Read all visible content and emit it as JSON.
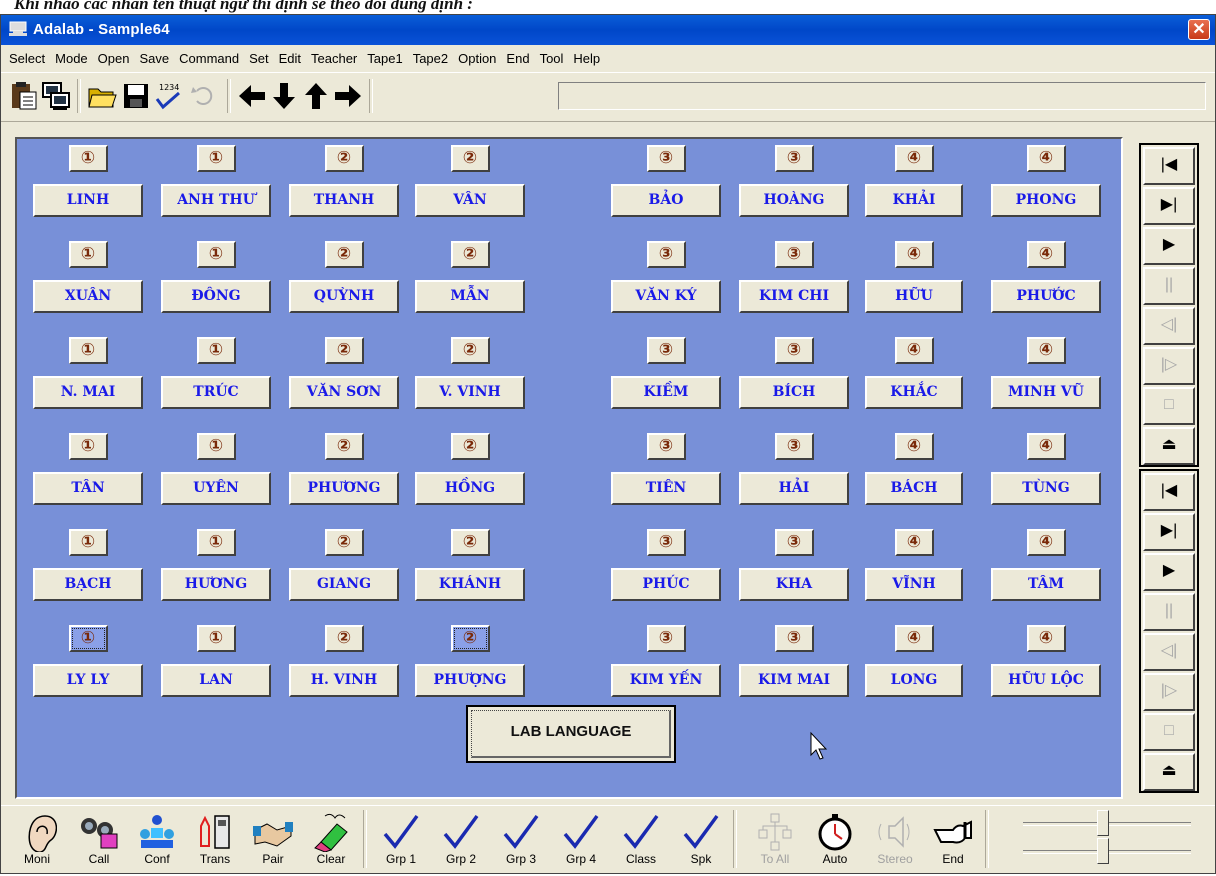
{
  "doc_caption": "Khi nhảo các nhấn tên thuật ngữ thì định sẽ theo dõi đúng định :",
  "window": {
    "title": "Adalab - Sample64",
    "close_glyph": "✕"
  },
  "menu": [
    "Select",
    "Mode",
    "Open",
    "Save",
    "Command",
    "Set",
    "Edit",
    "Teacher",
    "Tape1",
    "Tape2",
    "Option",
    "End",
    "Tool",
    "Help"
  ],
  "toolbar_icons": [
    "clipboard-icon",
    "monitor-icon",
    "open-folder-icon",
    "save-icon",
    "check-1234-icon",
    "undo-icon",
    "arrow-left-icon",
    "arrow-down-icon",
    "arrow-up-icon",
    "arrow-right-icon"
  ],
  "groups": [
    "①",
    "②",
    "③",
    "④"
  ],
  "rows": [
    [
      {
        "g": "①",
        "n": "LINH"
      },
      {
        "g": "①",
        "n": "ANH THƯ"
      },
      {
        "g": "②",
        "n": "THANH"
      },
      {
        "g": "②",
        "n": "VÂN"
      },
      {
        "g": "③",
        "n": "BẢO"
      },
      {
        "g": "③",
        "n": "HOÀNG"
      },
      {
        "g": "④",
        "n": "KHẢI"
      },
      {
        "g": "④",
        "n": "PHONG"
      }
    ],
    [
      {
        "g": "①",
        "n": "XUÂN"
      },
      {
        "g": "①",
        "n": "ĐÔNG"
      },
      {
        "g": "②",
        "n": "QUỲNH"
      },
      {
        "g": "②",
        "n": "MẪN"
      },
      {
        "g": "③",
        "n": "VĂN KÝ"
      },
      {
        "g": "③",
        "n": "KIM CHI"
      },
      {
        "g": "④",
        "n": "HỮU"
      },
      {
        "g": "④",
        "n": "PHƯỚC"
      }
    ],
    [
      {
        "g": "①",
        "n": "N. MAI"
      },
      {
        "g": "①",
        "n": "TRÚC"
      },
      {
        "g": "②",
        "n": "VĂN SƠN"
      },
      {
        "g": "②",
        "n": "V. VINH"
      },
      {
        "g": "③",
        "n": "KIỀM"
      },
      {
        "g": "③",
        "n": "BÍCH"
      },
      {
        "g": "④",
        "n": "KHẮC"
      },
      {
        "g": "④",
        "n": "MINH VŨ"
      }
    ],
    [
      {
        "g": "①",
        "n": "TÂN"
      },
      {
        "g": "①",
        "n": "UYÊN"
      },
      {
        "g": "②",
        "n": "PHƯƠNG"
      },
      {
        "g": "②",
        "n": "HỒNG"
      },
      {
        "g": "③",
        "n": "TIÊN"
      },
      {
        "g": "③",
        "n": "HẢI"
      },
      {
        "g": "④",
        "n": "BÁCH"
      },
      {
        "g": "④",
        "n": "TÙNG"
      }
    ],
    [
      {
        "g": "①",
        "n": "BẠCH"
      },
      {
        "g": "①",
        "n": "HƯƠNG"
      },
      {
        "g": "②",
        "n": "GIANG"
      },
      {
        "g": "②",
        "n": "KHÁNH"
      },
      {
        "g": "③",
        "n": "PHÚC"
      },
      {
        "g": "③",
        "n": "KHA"
      },
      {
        "g": "④",
        "n": "VĨNH"
      },
      {
        "g": "④",
        "n": "TÂM"
      }
    ],
    [
      {
        "g": "①",
        "n": "LY LY",
        "sel": true
      },
      {
        "g": "①",
        "n": "LAN"
      },
      {
        "g": "②",
        "n": "H. VINH"
      },
      {
        "g": "②",
        "n": "PHƯỢNG",
        "sel": true
      },
      {
        "g": "③",
        "n": "KIM YẾN"
      },
      {
        "g": "③",
        "n": "KIM MAI"
      },
      {
        "g": "④",
        "n": "LONG"
      },
      {
        "g": "④",
        "n": "HỮU LỘC"
      }
    ]
  ],
  "center_button": "LAB LANGUAGE",
  "tape_buttons": [
    {
      "icon": "skip-back-icon",
      "glyph": "|◀",
      "enabled": true
    },
    {
      "icon": "skip-forward-icon",
      "glyph": "▶|",
      "enabled": true
    },
    {
      "icon": "play-icon",
      "glyph": "▶",
      "enabled": true
    },
    {
      "icon": "pause-icon",
      "glyph": "||",
      "enabled": false
    },
    {
      "icon": "rewind-icon",
      "glyph": "◁|",
      "enabled": false
    },
    {
      "icon": "fast-forward-icon",
      "glyph": "|▷",
      "enabled": false
    },
    {
      "icon": "stop-icon",
      "glyph": "□",
      "enabled": false
    },
    {
      "icon": "eject-icon",
      "glyph": "⏏",
      "enabled": true
    }
  ],
  "bottom_tools": [
    {
      "label": "Moni",
      "icon": "ear-icon"
    },
    {
      "label": "Call",
      "icon": "binoculars-icon"
    },
    {
      "label": "Conf",
      "icon": "conference-icon"
    },
    {
      "label": "Trans",
      "icon": "transmit-icon"
    },
    {
      "label": "Pair",
      "icon": "handshake-icon"
    },
    {
      "label": "Clear",
      "icon": "eraser-icon"
    },
    {
      "label": "Grp 1",
      "icon": "check-icon"
    },
    {
      "label": "Grp 2",
      "icon": "check-icon"
    },
    {
      "label": "Grp 3",
      "icon": "check-icon"
    },
    {
      "label": "Grp 4",
      "icon": "check-icon"
    },
    {
      "label": "Class",
      "icon": "check-icon"
    },
    {
      "label": "Spk",
      "icon": "check-icon"
    },
    {
      "label": "To All",
      "icon": "network-icon",
      "disabled": true
    },
    {
      "label": "Auto",
      "icon": "stopwatch-icon"
    },
    {
      "label": "Stereo",
      "icon": "stereo-icon",
      "disabled": true
    },
    {
      "label": "End",
      "icon": "pointing-hand-icon"
    }
  ],
  "colors": {
    "panel": "#7890d8",
    "seat_text": "#1a1ae8",
    "group_text": "#7a2a0a",
    "titlebar": "#0047c8"
  }
}
